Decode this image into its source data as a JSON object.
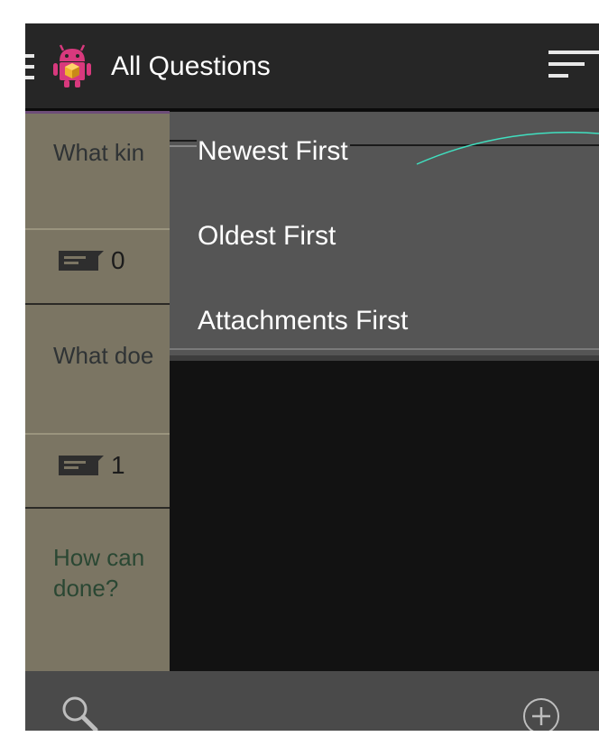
{
  "actionbar": {
    "title": "All Questions",
    "icons": {
      "drawer": "drawer-menu-icon",
      "app": "android-app-icon",
      "sort": "sort-icon"
    }
  },
  "questions": [
    {
      "text": "What kin",
      "comments": "0"
    },
    {
      "text": "What doe",
      "comments": "1"
    },
    {
      "text": "How can done?",
      "line1": "How can",
      "line2": "done?"
    }
  ],
  "sort_menu": {
    "items": [
      "Newest First",
      "Oldest First",
      "Attachments First"
    ]
  },
  "bottombar": {
    "icons": {
      "search": "search-icon",
      "add": "add-circle-icon"
    }
  },
  "colors": {
    "actionbar": "#262626",
    "list_bg": "#7b7563",
    "menu_bg": "#555555",
    "bottombar": "#4a4a4a",
    "accent_line": "#40e0c0"
  }
}
